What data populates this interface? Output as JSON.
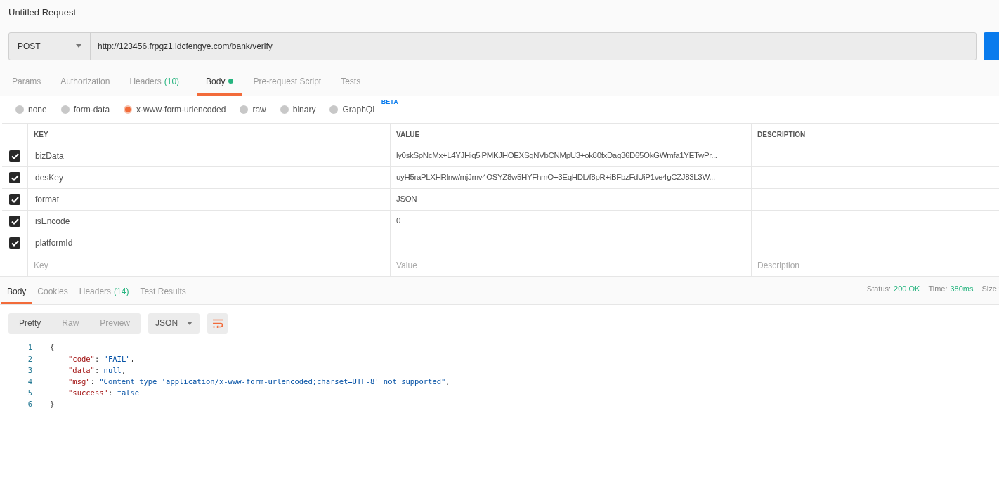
{
  "window": {
    "title": "Untitled Request"
  },
  "request": {
    "method": "POST",
    "url": "http://123456.frpgz1.idcfengye.com/bank/verify"
  },
  "request_tabs": [
    {
      "label": "Params",
      "selected": false
    },
    {
      "label": "Authorization",
      "selected": false
    },
    {
      "label": "Headers",
      "count": "(10)",
      "selected": false
    },
    {
      "label": "Body",
      "dot": true,
      "selected": true
    },
    {
      "label": "Pre-request Script",
      "selected": false
    },
    {
      "label": "Tests",
      "selected": false
    }
  ],
  "body_types": [
    {
      "label": "none",
      "selected": false
    },
    {
      "label": "form-data",
      "selected": false
    },
    {
      "label": "x-www-form-urlencoded",
      "selected": true
    },
    {
      "label": "raw",
      "selected": false
    },
    {
      "label": "binary",
      "selected": false
    },
    {
      "label": "GraphQL",
      "badge": "BETA",
      "selected": false
    }
  ],
  "table": {
    "columns": [
      "KEY",
      "VALUE",
      "DESCRIPTION"
    ],
    "rows": [
      {
        "checked": true,
        "key": "bizData",
        "value": "ly0skSpNcMx+L4YJHiq5lPMKJHOEXSgNVbCNMpU3+ok80fxDag36D65OkGWmfa1YETwPr..."
      },
      {
        "checked": true,
        "key": "desKey",
        "value": "uyH5raPLXHRlnw/mjJmv4OSYZ8w5HYFhmO+3EqHDL/f8pR+iBFbzFdUiP1ve4gCZJ83L3W..."
      },
      {
        "checked": true,
        "key": "format",
        "value": "JSON"
      },
      {
        "checked": true,
        "key": "isEncode",
        "value": "0"
      },
      {
        "checked": true,
        "key": "platformId"
      }
    ],
    "placeholders": [
      "Key",
      "Value",
      "Description"
    ]
  },
  "response_tabs": [
    {
      "label": "Body",
      "selected": true
    },
    {
      "label": "Cookies",
      "selected": false
    },
    {
      "label": "Headers",
      "count": "(14)",
      "selected": false
    },
    {
      "label": "Test Results",
      "selected": false
    }
  ],
  "status": [
    {
      "label": "Status:",
      "value": "200 OK"
    },
    {
      "label": "Time:",
      "value": "380ms"
    },
    {
      "label": "Size:"
    }
  ],
  "view_modes": [
    {
      "label": "Pretty",
      "selected": true
    },
    {
      "label": "Raw",
      "selected": false
    },
    {
      "label": "Preview",
      "selected": false
    }
  ],
  "format": "JSON",
  "code_lines": [
    {
      "number": "1",
      "tokens": [
        {
          "kind": "punct",
          "text": "{"
        }
      ]
    },
    {
      "number": "2",
      "tokens": [
        {
          "kind": "key",
          "text": "\"code\""
        },
        {
          "kind": "punct",
          "text": ": "
        },
        {
          "kind": "string",
          "text": "\"FAIL\""
        },
        {
          "kind": "punct",
          "text": ","
        }
      ]
    },
    {
      "number": "3",
      "tokens": [
        {
          "kind": "key",
          "text": "\"data\""
        },
        {
          "kind": "punct",
          "text": ": "
        },
        {
          "kind": "literal",
          "text": "null"
        },
        {
          "kind": "punct",
          "text": ","
        }
      ]
    },
    {
      "number": "4",
      "tokens": [
        {
          "kind": "key",
          "text": "\"msg\""
        },
        {
          "kind": "punct",
          "text": ": "
        },
        {
          "kind": "string",
          "text": "\"Content type 'application/x-www-form-urlencoded;charset=UTF-8' not supported\""
        },
        {
          "kind": "punct",
          "text": ","
        }
      ]
    },
    {
      "number": "5",
      "tokens": [
        {
          "kind": "key",
          "text": "\"success\""
        },
        {
          "kind": "punct",
          "text": ": "
        },
        {
          "kind": "literal",
          "text": "false"
        }
      ]
    },
    {
      "number": "6",
      "tokens": [
        {
          "kind": "punct",
          "text": "}"
        }
      ]
    }
  ]
}
